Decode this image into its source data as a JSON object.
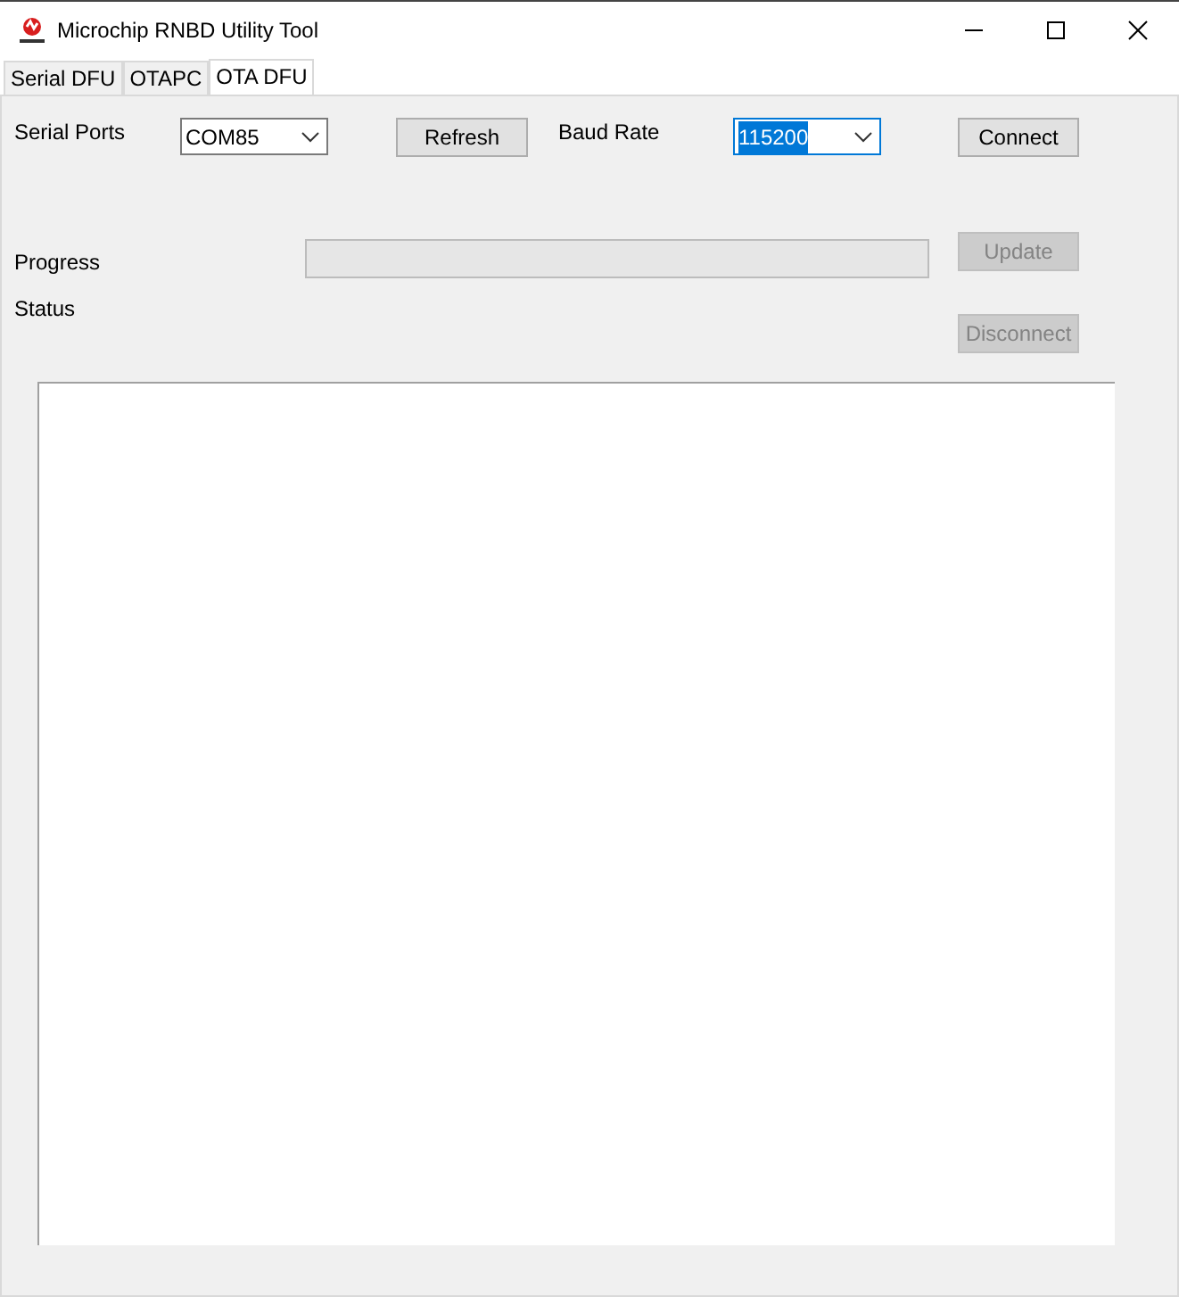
{
  "window": {
    "title": "Microchip RNBD Utility Tool"
  },
  "tabs": [
    {
      "label": "Serial DFU",
      "selected": false
    },
    {
      "label": "OTAPC",
      "selected": false
    },
    {
      "label": "OTA DFU",
      "selected": true
    }
  ],
  "serial_ports": {
    "label": "Serial Ports",
    "value": "COM85",
    "focused": false
  },
  "refresh_button": {
    "label": "Refresh",
    "disabled": false
  },
  "baud_rate": {
    "label": "Baud Rate",
    "value": "115200",
    "focused": true
  },
  "connect_button": {
    "label": "Connect",
    "disabled": false
  },
  "progress": {
    "label": "Progress",
    "level": 0
  },
  "update_button": {
    "label": "Update",
    "disabled": true
  },
  "status": {
    "label": "Status"
  },
  "disconnect_button": {
    "label": "Disconnect",
    "disabled": true
  }
}
